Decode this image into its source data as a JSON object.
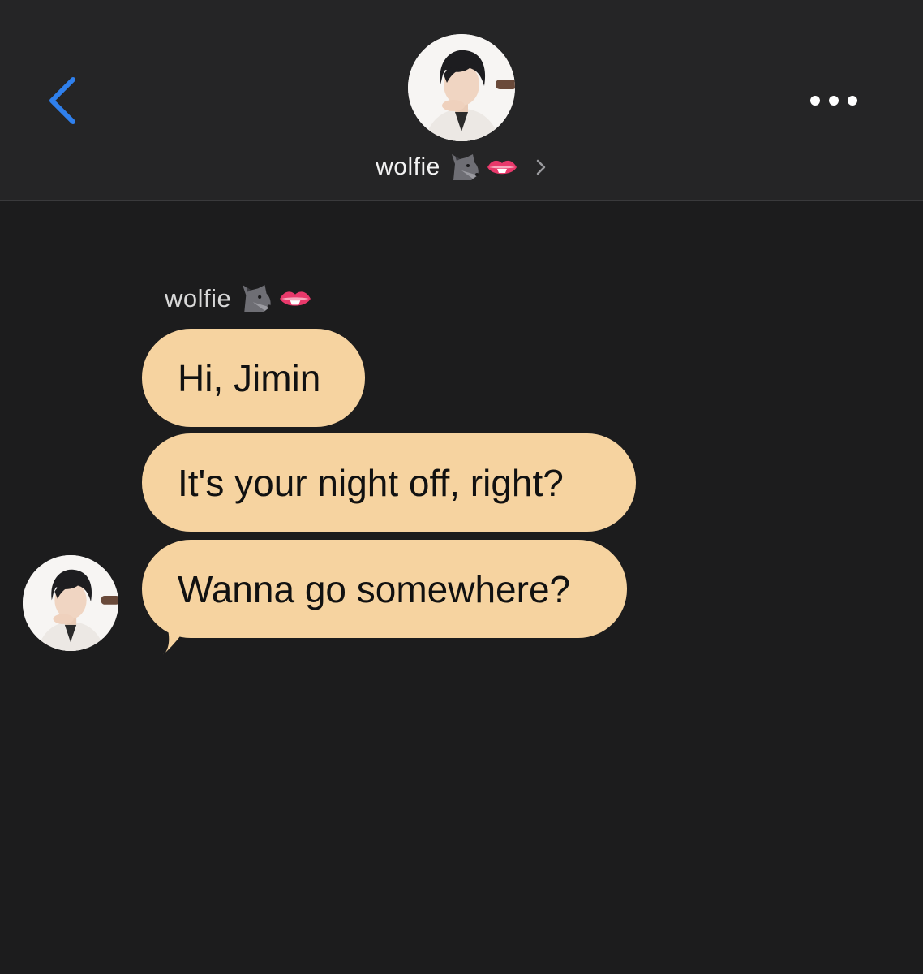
{
  "header": {
    "back_icon": "chevron-left-icon",
    "more_icon": "ellipsis-icon",
    "contact_name": "wolfie",
    "contact_emojis": [
      "wolf-emoji-icon",
      "lips-emoji-icon"
    ],
    "contact_chevron_icon": "chevron-right-icon"
  },
  "conversation": {
    "sender_name": "wolfie",
    "sender_emojis": [
      "wolf-emoji-icon",
      "lips-emoji-icon"
    ],
    "messages": [
      {
        "text": "Hi, Jimin"
      },
      {
        "text": "It's your night off, right?"
      },
      {
        "text": "Wanna go somewhere?"
      }
    ]
  },
  "colors": {
    "background": "#1c1c1d",
    "header_background": "#252526",
    "accent_blue": "#2f80ed",
    "bubble": "#f6d3a0",
    "bubble_text": "#111111",
    "name_text": "#f2f2f2"
  }
}
